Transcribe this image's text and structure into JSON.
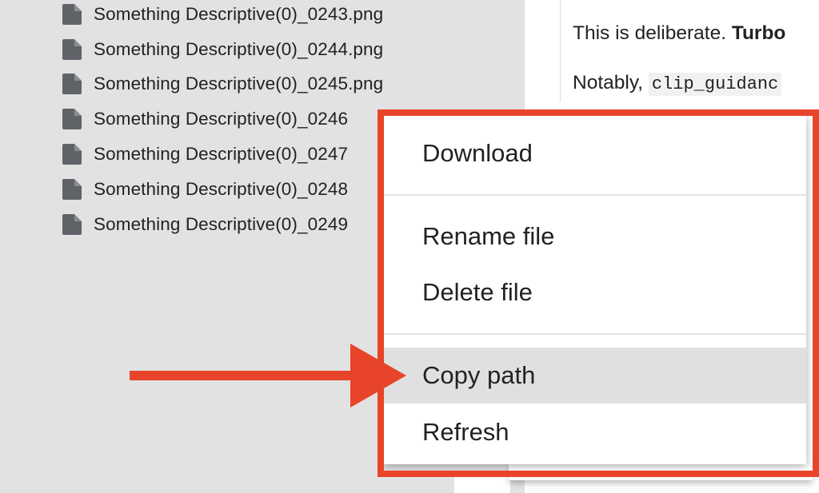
{
  "file_browser": {
    "files": [
      {
        "name": "Something Descriptive(0)_0243.png",
        "icon": "file-icon"
      },
      {
        "name": "Something Descriptive(0)_0244.png",
        "icon": "file-icon"
      },
      {
        "name": "Something Descriptive(0)_0245.png",
        "icon": "file-icon"
      },
      {
        "name": "Something Descriptive(0)_0246",
        "icon": "file-icon"
      },
      {
        "name": "Something Descriptive(0)_0247",
        "icon": "file-icon"
      },
      {
        "name": "Something Descriptive(0)_0248",
        "icon": "file-icon"
      },
      {
        "name": "Something Descriptive(0)_0249",
        "icon": "file-icon"
      }
    ]
  },
  "notebook": {
    "line1_prefix": "This is deliberate. ",
    "line1_bold": "Turbo",
    "line2_prefix": "Notably, ",
    "line2_code": "clip_guidanc"
  },
  "context_menu": {
    "download": "Download",
    "rename": "Rename file",
    "delete": "Delete file",
    "copy_path": "Copy path",
    "refresh": "Refresh",
    "highlighted_item": "Copy path"
  },
  "annotation": {
    "color": "#e8442a",
    "target": "Copy path"
  },
  "colors": {
    "panel_bg": "#e2e2e2",
    "menu_hover": "#e0e0e0",
    "text": "#222222"
  }
}
